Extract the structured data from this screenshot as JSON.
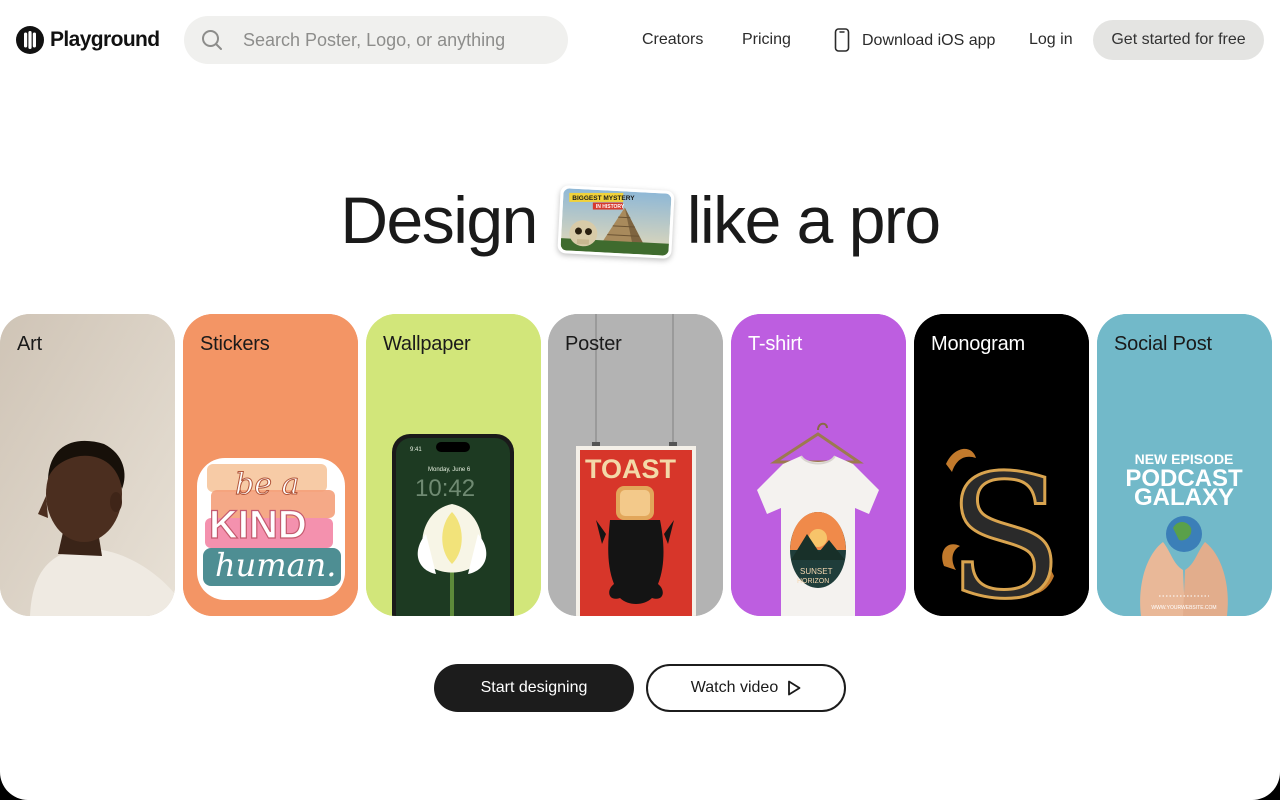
{
  "brand": {
    "name": "Playground"
  },
  "search": {
    "placeholder": "Search Poster, Logo, or anything",
    "value": ""
  },
  "nav": {
    "creators": "Creators",
    "pricing": "Pricing",
    "download_ios": "Download iOS app",
    "login": "Log in",
    "get_started": "Get started for free"
  },
  "hero": {
    "before": "Design",
    "after": "like a pro"
  },
  "categories": [
    {
      "label": "Art",
      "bg": "#d8cfc3",
      "text_color": "#1a1a1a"
    },
    {
      "label": "Stickers",
      "bg": "#f39565",
      "text_color": "#1a1a1a"
    },
    {
      "label": "Wallpaper",
      "bg": "#d2e67a",
      "text_color": "#1a1a1a"
    },
    {
      "label": "Poster",
      "bg": "#b3b3b3",
      "text_color": "#1a1a1a"
    },
    {
      "label": "T-shirt",
      "bg": "#bd5ee0",
      "text_color": "#ffffff"
    },
    {
      "label": "Monogram",
      "bg": "#000000",
      "text_color": "#ffffff"
    },
    {
      "label": "Social Post",
      "bg": "#72b9c9",
      "text_color": "#1a1a1a"
    }
  ],
  "card_content": {
    "sticker_line1": "be a",
    "sticker_line2": "KIND",
    "sticker_line3": "human.",
    "wallpaper_date": "Monday, June 6",
    "wallpaper_time": "10:42",
    "wallpaper_status": "9:41",
    "poster_title": "TOAST",
    "tshirt_line1": "SUNSET",
    "tshirt_line2": "HORIZON",
    "monogram_letter": "S",
    "social_line1": "NEW EPISODE",
    "social_line2": "PODCAST",
    "social_line3": "GALAXY",
    "social_footer": "WWW.YOURWEBSITE.COM"
  },
  "hero_thumb": {
    "line1": "BIGGEST MYSTERY",
    "line2": "IN HISTORY"
  },
  "actions": {
    "start": "Start designing",
    "watch": "Watch video"
  },
  "icons": {
    "logo": "playground-logo-icon",
    "search": "search-icon",
    "phone": "phone-icon",
    "play": "play-icon"
  },
  "colors": {
    "primary_button": "#1c1c1c",
    "search_bg": "#f0f0ee",
    "cta_bg": "#e4e4e2"
  }
}
